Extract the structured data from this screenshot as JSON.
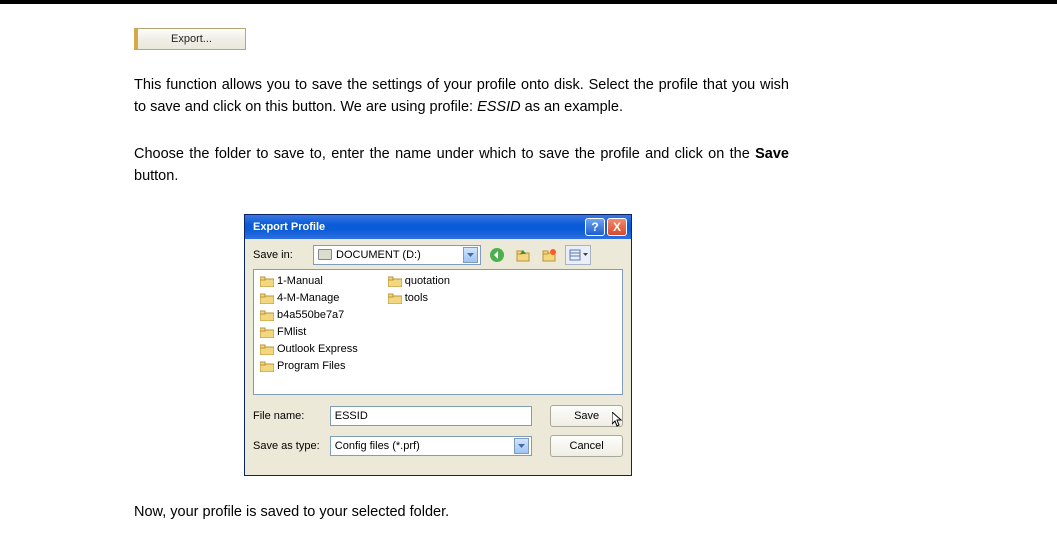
{
  "export_button_label": "Export...",
  "para1_a": "This function allows you to save the settings of your profile onto disk. Select the profile that you wish to save and click on this button. We are using profile: ",
  "para1_essid": "ESSID",
  "para1_b": " as an example.",
  "para2_a": "Choose the folder to save to, enter the name under which to save the profile and click on the ",
  "para2_save": "Save",
  "para2_b": " button.",
  "para3": "Now, your profile is saved to your selected folder.",
  "dialog": {
    "title": "Export Profile",
    "help": "?",
    "close": "X",
    "save_in_label": "Save in:",
    "save_in_value": "DOCUMENT (D:)",
    "files_col1": [
      "1-Manual",
      "4-M-Manage",
      "b4a550be7a7",
      "FMlist",
      "Outlook Express",
      "Program Files"
    ],
    "files_col2": [
      "quotation",
      "tools"
    ],
    "filename_label": "File name:",
    "filename_value": "ESSID",
    "savetype_label": "Save as type:",
    "savetype_value": "Config files (*.prf)",
    "save_btn": "Save",
    "cancel_btn": "Cancel"
  }
}
